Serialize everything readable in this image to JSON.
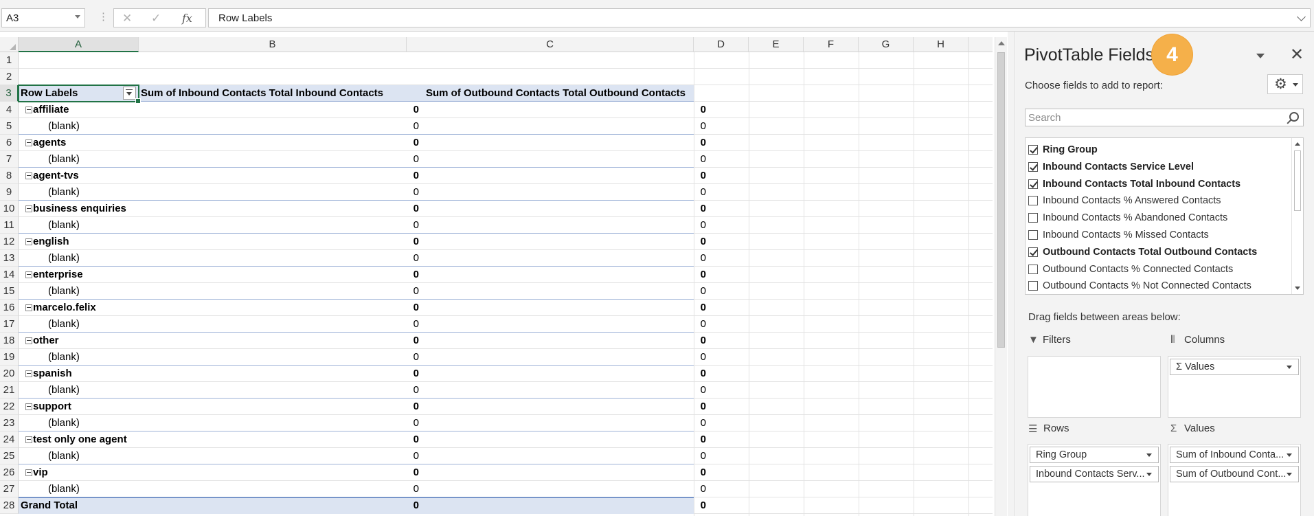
{
  "formula_bar": {
    "name_box": "A3",
    "cancel_icon": "✕",
    "enter_icon": "✓",
    "fx_label": "fx",
    "formula_value": "Row Labels"
  },
  "columns": [
    "A",
    "B",
    "C",
    "D",
    "E",
    "F",
    "G",
    "H"
  ],
  "rows": [
    {
      "num": "1",
      "kind": "empty",
      "a": "",
      "b": "",
      "c": ""
    },
    {
      "num": "2",
      "kind": "empty",
      "a": "",
      "b": "",
      "c": ""
    },
    {
      "num": "3",
      "kind": "header",
      "a": "Row Labels",
      "b": "Sum of Inbound Contacts Total Inbound Contacts",
      "c": "Sum of Outbound Contacts Total Outbound Contacts"
    },
    {
      "num": "4",
      "kind": "group",
      "a": "affiliate",
      "b": "0",
      "c": "0"
    },
    {
      "num": "5",
      "kind": "sub",
      "a": "(blank)",
      "b": "0",
      "c": "0"
    },
    {
      "num": "6",
      "kind": "group",
      "a": "agents",
      "b": "0",
      "c": "0"
    },
    {
      "num": "7",
      "kind": "sub",
      "a": "(blank)",
      "b": "0",
      "c": "0"
    },
    {
      "num": "8",
      "kind": "group",
      "a": "agent-tvs",
      "b": "0",
      "c": "0"
    },
    {
      "num": "9",
      "kind": "sub",
      "a": "(blank)",
      "b": "0",
      "c": "0"
    },
    {
      "num": "10",
      "kind": "group",
      "a": "business enquiries",
      "b": "0",
      "c": "0"
    },
    {
      "num": "11",
      "kind": "sub",
      "a": "(blank)",
      "b": "0",
      "c": "0"
    },
    {
      "num": "12",
      "kind": "group",
      "a": "english",
      "b": "0",
      "c": "0"
    },
    {
      "num": "13",
      "kind": "sub",
      "a": "(blank)",
      "b": "0",
      "c": "0"
    },
    {
      "num": "14",
      "kind": "group",
      "a": "enterprise",
      "b": "0",
      "c": "0"
    },
    {
      "num": "15",
      "kind": "sub",
      "a": "(blank)",
      "b": "0",
      "c": "0"
    },
    {
      "num": "16",
      "kind": "group",
      "a": "marcelo.felix",
      "b": "0",
      "c": "0"
    },
    {
      "num": "17",
      "kind": "sub",
      "a": "(blank)",
      "b": "0",
      "c": "0"
    },
    {
      "num": "18",
      "kind": "group",
      "a": "other",
      "b": "0",
      "c": "0"
    },
    {
      "num": "19",
      "kind": "sub",
      "a": "(blank)",
      "b": "0",
      "c": "0"
    },
    {
      "num": "20",
      "kind": "group",
      "a": "spanish",
      "b": "0",
      "c": "0"
    },
    {
      "num": "21",
      "kind": "sub",
      "a": "(blank)",
      "b": "0",
      "c": "0"
    },
    {
      "num": "22",
      "kind": "group",
      "a": "support",
      "b": "0",
      "c": "0"
    },
    {
      "num": "23",
      "kind": "sub",
      "a": "(blank)",
      "b": "0",
      "c": "0"
    },
    {
      "num": "24",
      "kind": "group",
      "a": "test only one agent",
      "b": "0",
      "c": "0"
    },
    {
      "num": "25",
      "kind": "sub",
      "a": "(blank)",
      "b": "0",
      "c": "0"
    },
    {
      "num": "26",
      "kind": "group",
      "a": "vip",
      "b": "0",
      "c": "0"
    },
    {
      "num": "27",
      "kind": "sub",
      "a": "(blank)",
      "b": "0",
      "c": "0"
    },
    {
      "num": "28",
      "kind": "total",
      "a": "Grand Total",
      "b": "0",
      "c": "0"
    }
  ],
  "pivot_pane": {
    "title": "PivotTable Fields",
    "badge": "4",
    "close_icon": "✕",
    "choose_label": "Choose fields to add to report:",
    "gear_icon": "⚙",
    "search_placeholder": "Search",
    "fields": [
      {
        "label": "Ring Group",
        "checked": true
      },
      {
        "label": "Inbound Contacts Service Level",
        "checked": true
      },
      {
        "label": "Inbound Contacts Total Inbound Contacts",
        "checked": true
      },
      {
        "label": "Inbound Contacts % Answered Contacts",
        "checked": false
      },
      {
        "label": "Inbound Contacts % Abandoned Contacts",
        "checked": false
      },
      {
        "label": "Inbound Contacts % Missed Contacts",
        "checked": false
      },
      {
        "label": "Outbound Contacts Total Outbound Contacts",
        "checked": true
      },
      {
        "label": "Outbound Contacts % Connected Contacts",
        "checked": false
      },
      {
        "label": "Outbound Contacts % Not Connected Contacts",
        "checked": false
      }
    ],
    "drag_label": "Drag fields between areas below:",
    "areas": {
      "filters": {
        "title": "Filters",
        "icon": "▼",
        "items": []
      },
      "columns": {
        "title": "Columns",
        "icon": "⦀",
        "items": [
          "Σ Values"
        ]
      },
      "rows": {
        "title": "Rows",
        "icon": "☰",
        "items": [
          "Ring Group",
          "Inbound Contacts Serv..."
        ]
      },
      "values": {
        "title": "Values",
        "icon": "Σ",
        "items": [
          "Sum of Inbound Conta...",
          "Sum of Outbound Cont..."
        ]
      }
    }
  },
  "colors": {
    "accent": "#217346",
    "pivot_header": "#dce4f2",
    "badge": "#f5b04a"
  }
}
